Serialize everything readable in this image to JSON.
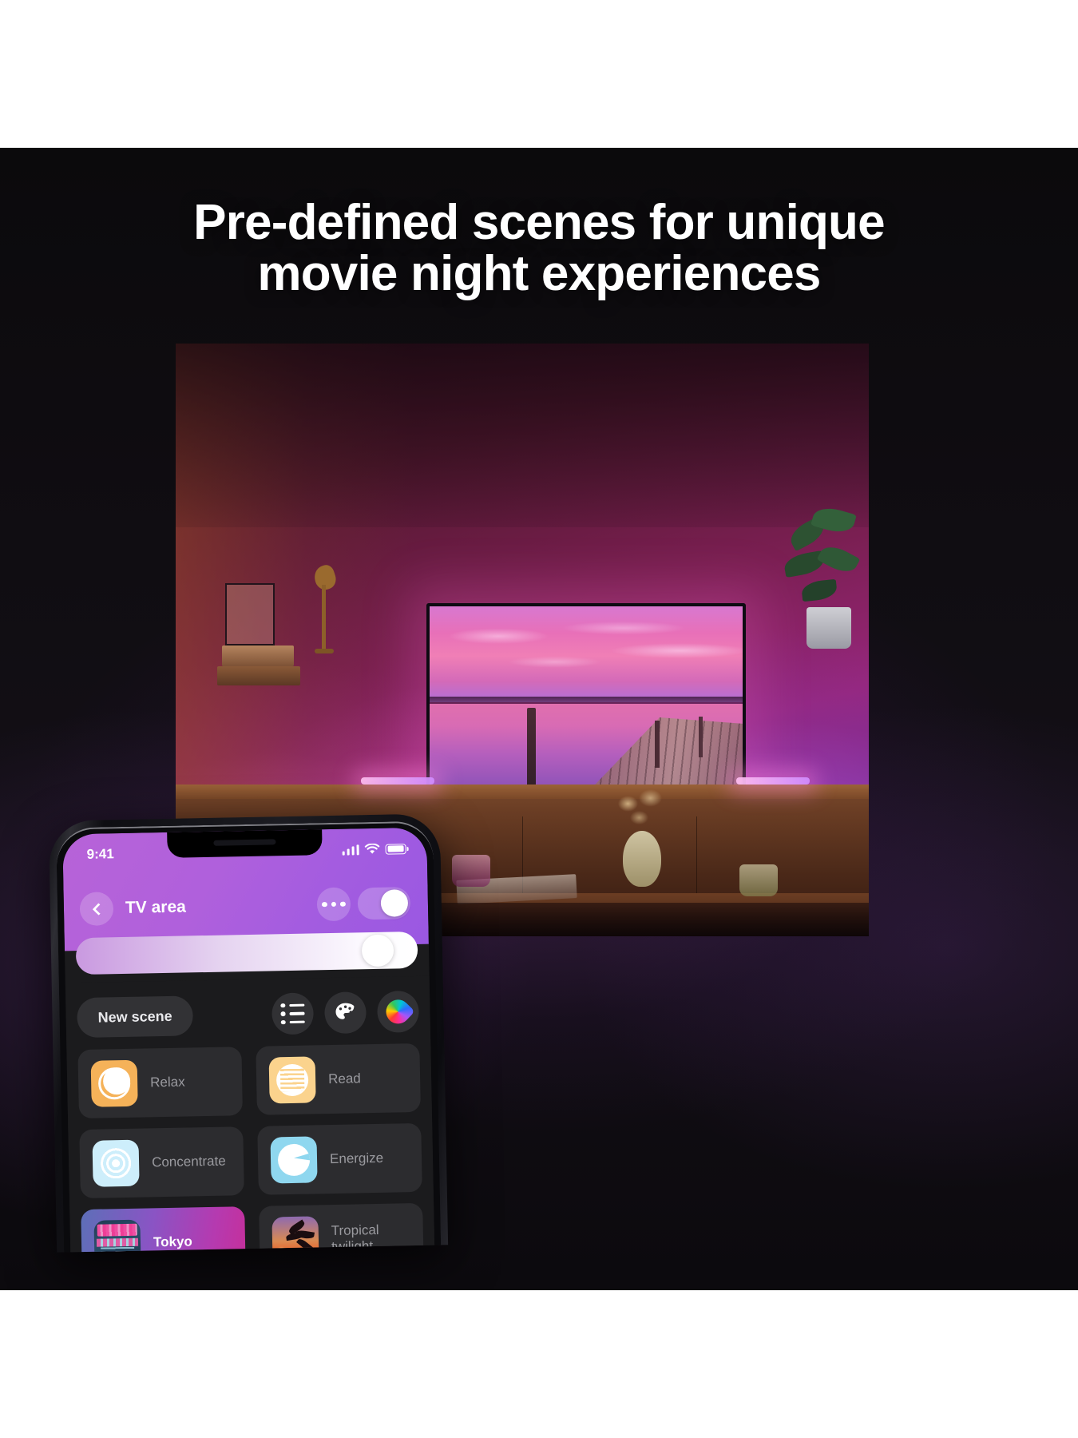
{
  "headline": "Pre-defined scenes for unique\nmovie night experiences",
  "phone": {
    "status": {
      "time": "9:41",
      "signal_icon": "cellular-bars-icon",
      "wifi_icon": "wifi-icon",
      "battery_icon": "battery-full-icon"
    },
    "header": {
      "back_icon": "chevron-left-icon",
      "title": "TV area",
      "more_icon": "more-options-icon",
      "power_toggle": "on",
      "accent_color": "#a95ee0"
    },
    "brightness": {
      "label": "brightness-slider",
      "value_percent": 93
    },
    "toolbar": {
      "new_scene_label": "New scene",
      "list_icon": "list-view-icon",
      "palette_icon": "color-palette-icon",
      "color_wheel_icon": "color-wheel-icon"
    },
    "scenes": [
      {
        "name": "Relax",
        "icon": "relax-icon",
        "icon_class": "ic-relax",
        "active": false
      },
      {
        "name": "Read",
        "icon": "read-icon",
        "icon_class": "ic-read",
        "active": false
      },
      {
        "name": "Concentrate",
        "icon": "concentrate-icon",
        "icon_class": "ic-conc",
        "active": false
      },
      {
        "name": "Energize",
        "icon": "energize-icon",
        "icon_class": "ic-energ",
        "active": false
      },
      {
        "name": "Tokyo",
        "icon": "tokyo-scene-icon",
        "icon_class": "ic-tokyo",
        "active": true
      },
      {
        "name": "Tropical twilight",
        "icon": "tropical-twilight-icon",
        "icon_class": "ic-trop",
        "active": false
      }
    ]
  }
}
